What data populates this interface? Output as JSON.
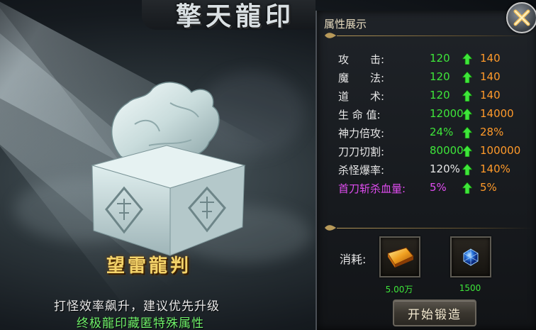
{
  "window": {
    "title": "擎天龍印",
    "close_icon": "close-x-icon"
  },
  "art": {
    "item_name": "望雷龍判",
    "description_line1": "打怪效率飙升，建议优先升级",
    "description_line2": "终极龍印藏匿特殊属性"
  },
  "panel": {
    "header": "属性展示",
    "stats": [
      {
        "label": "攻　　击:",
        "current": "120",
        "next": "140",
        "color": "green"
      },
      {
        "label": "魔　　法:",
        "current": "120",
        "next": "140",
        "color": "green"
      },
      {
        "label": "道　　术:",
        "current": "120",
        "next": "140",
        "color": "green"
      },
      {
        "label": "生 命 值:",
        "current": "12000",
        "next": "14000",
        "color": "green"
      },
      {
        "label": "神力倍攻:",
        "current": "24%",
        "next": "28%",
        "color": "green"
      },
      {
        "label": "刀刀切割:",
        "current": "80000",
        "next": "100000",
        "color": "green"
      },
      {
        "label": "杀怪爆率:",
        "current": "120%",
        "next": "140%",
        "color": "white"
      },
      {
        "label": "首刀斩杀血量:",
        "current": "5%",
        "next": "5%",
        "color": "purple"
      }
    ],
    "cost_label": "消耗:",
    "costs": [
      {
        "icon": "gold-ingot-icon",
        "amount": "5.00万"
      },
      {
        "icon": "blue-gem-icon",
        "amount": "1500"
      }
    ],
    "forge_button": "开始锻造"
  },
  "colors": {
    "current_green": "#3ee63a",
    "next_orange": "#ff9a2a",
    "special_purple": "#e04cf0",
    "name_gold": "#f4d36a"
  }
}
